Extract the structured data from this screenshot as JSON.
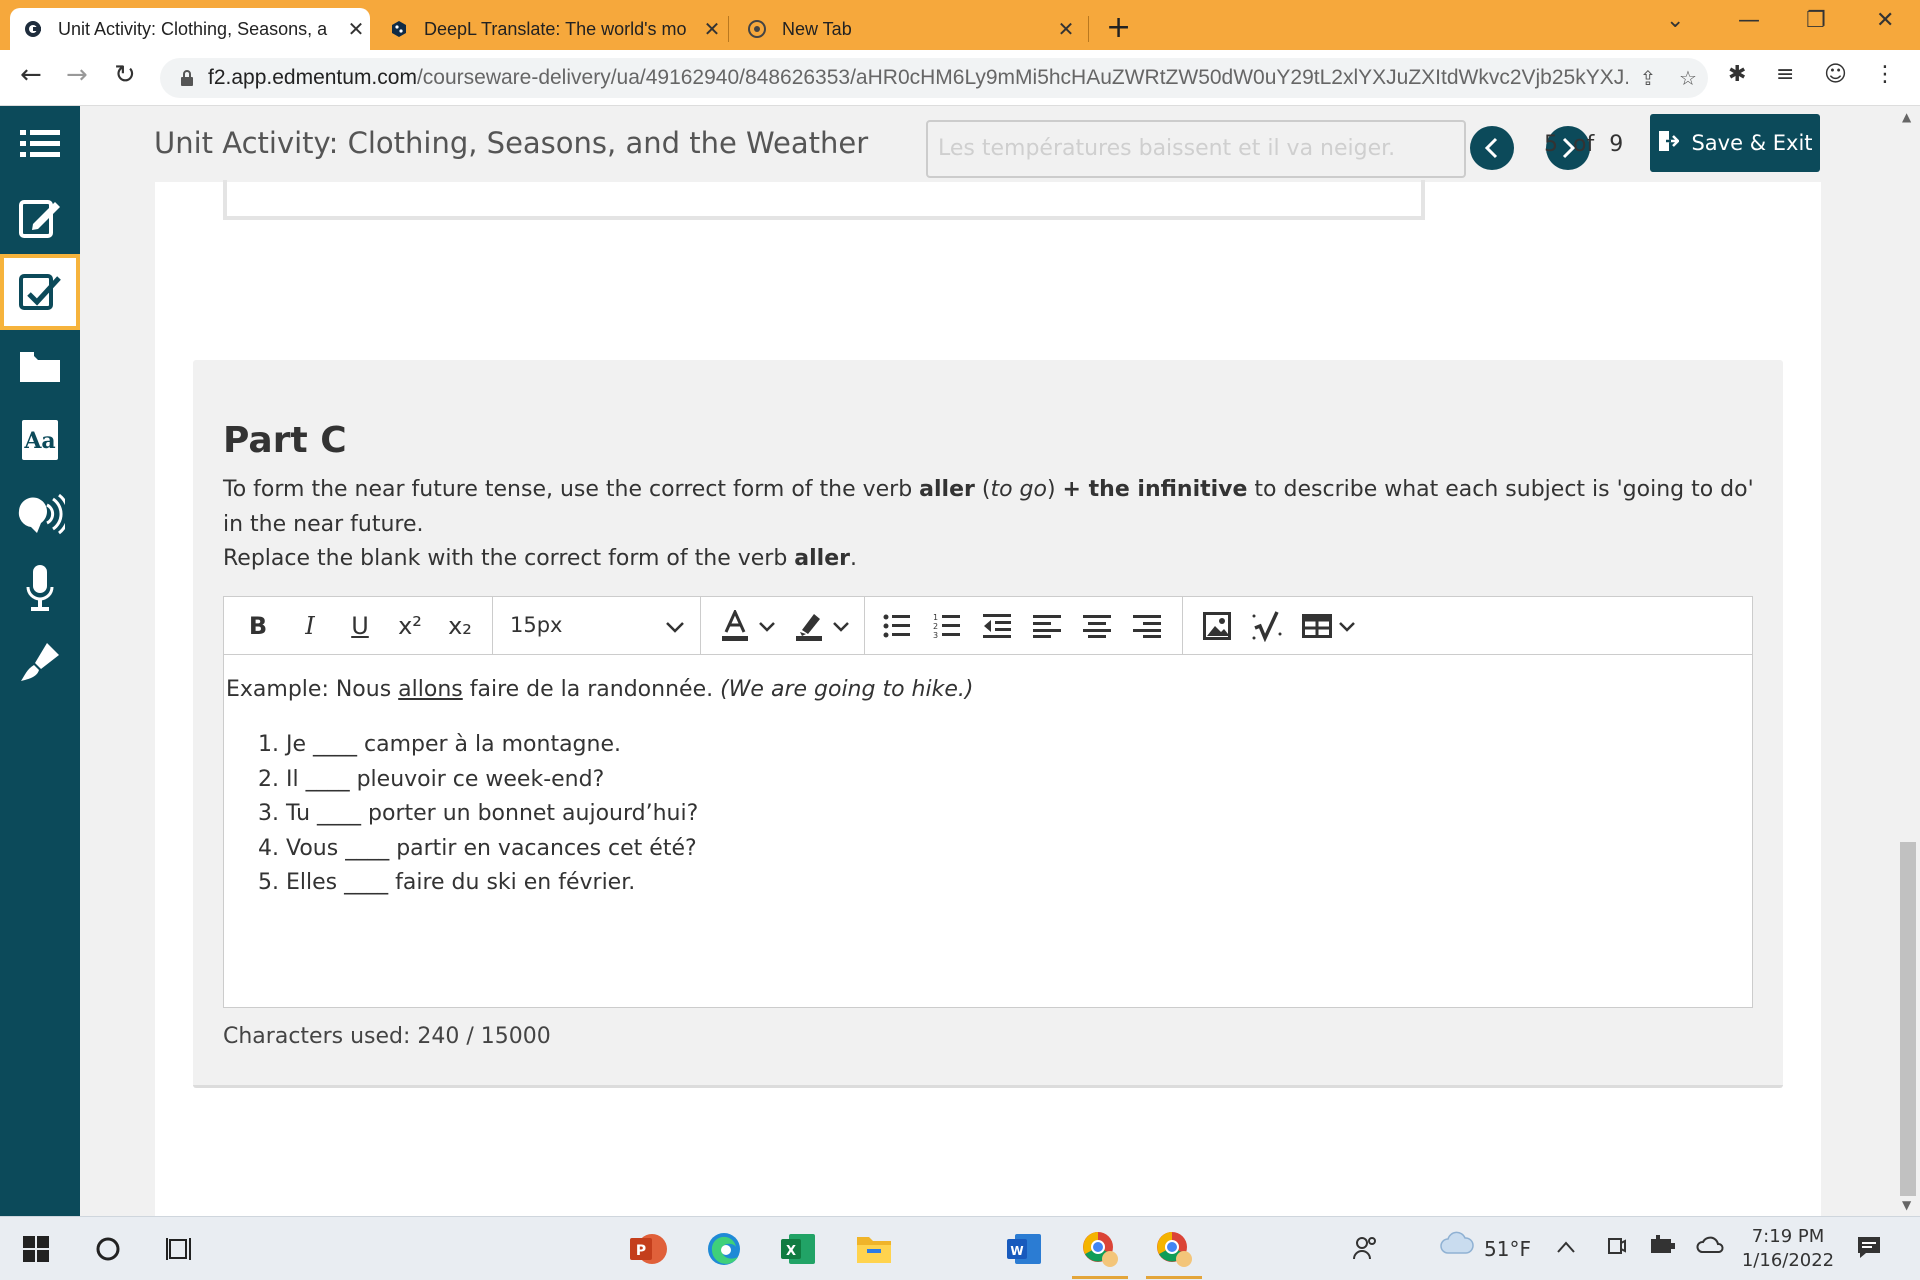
{
  "browser": {
    "tabs": [
      {
        "title": "Unit Activity: Clothing, Seasons, a",
        "active": true
      },
      {
        "title": "DeepL Translate: The world's mo",
        "active": false
      },
      {
        "title": "New Tab",
        "active": false
      }
    ],
    "url_host": "f2.app.edmentum.com",
    "url_path": "/courseware-delivery/ua/49162940/848626353/aHR0cHM6Ly9mMi5hcHAuZWRtZW50dW0uY29tL2xlYXJuZXItdWkvc2Vjb25kYXJ..."
  },
  "activity": {
    "title": "Unit Activity: Clothing, Seasons, and the Weather",
    "ghost_text": "Les températures baissent et il va neiger.",
    "page_current": "5",
    "page_of": "of",
    "page_total": "9",
    "save_exit_label": "Save & Exit"
  },
  "part_c": {
    "heading": "Part C",
    "instr_a": "To form the near future tense, use the correct form of the verb ",
    "instr_aller": "aller",
    "instr_open": " (",
    "instr_togo": "to go",
    "instr_close": ") ",
    "instr_plus": "+ the infinitive",
    "instr_b": " to describe what each subject is 'going to do' in the near future.",
    "replace_a": "Replace the blank with the correct form of the verb ",
    "replace_aller": "aller",
    "replace_dot": ".",
    "editor": {
      "font_size": "15px",
      "example_a": "Example: Nous ",
      "example_verb": "allons",
      "example_b": " faire de la randonnée. ",
      "example_tr": "(We are going to hike.)",
      "items": [
        "Je ____ camper à la montagne.",
        "Il ____ pleuvoir ce week-end?",
        "Tu ____ porter un bonnet aujourd’hui?",
        "Vous ____ partir en vacances cet été?",
        "Elles ____ faire du ski en février."
      ]
    },
    "counter": "Characters used: 240 / 15000"
  },
  "taskbar": {
    "weather": "51°F",
    "time": "7:19 PM",
    "date": "1/16/2022"
  },
  "colors": {
    "tab_strip": "#f6a83c",
    "sidebar": "#0c4a5a",
    "accent": "#f6b33c"
  }
}
